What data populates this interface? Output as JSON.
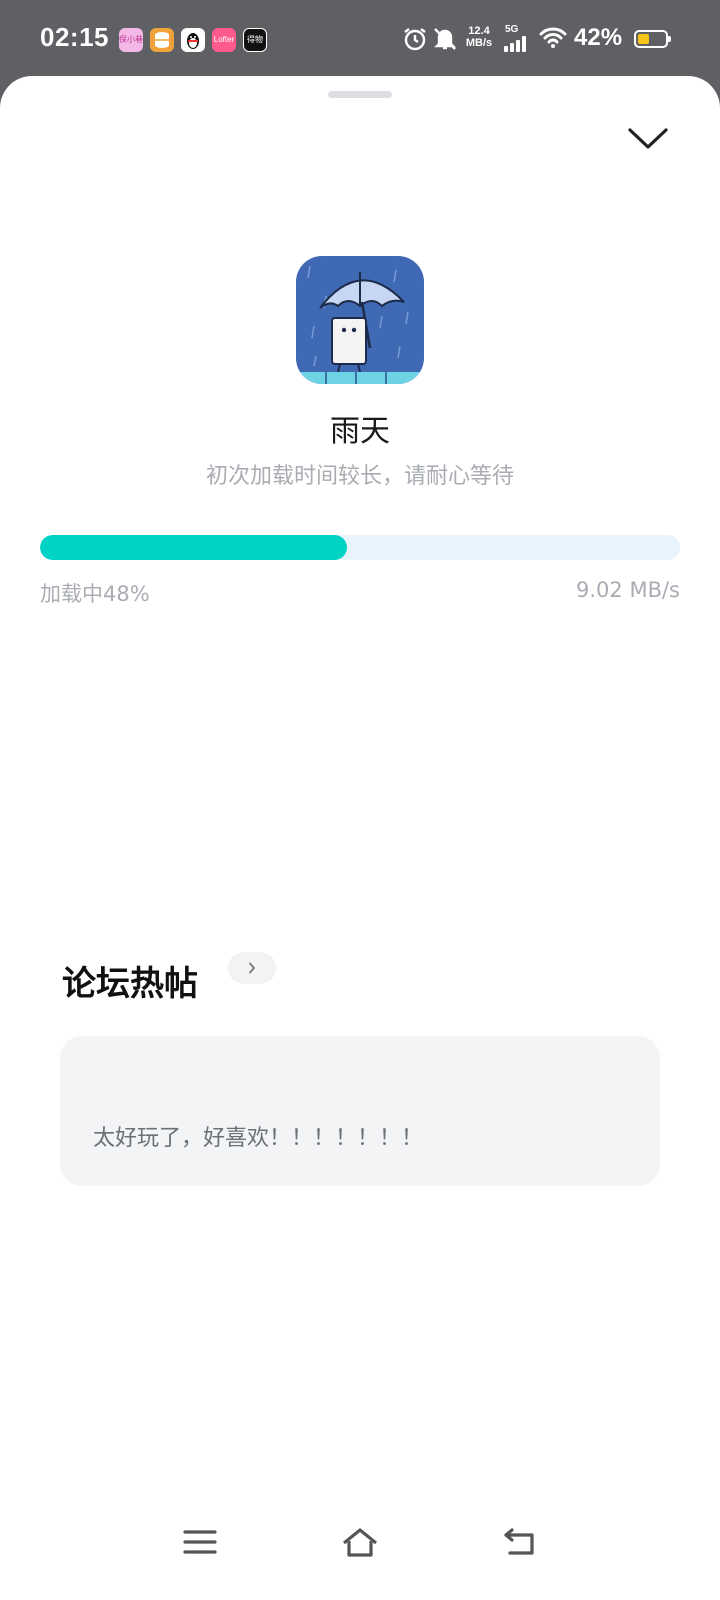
{
  "status_bar": {
    "time": "02:15",
    "notifications": [
      {
        "icon": "app-notification-icon",
        "text": "保小巷"
      },
      {
        "icon": "database-app-icon",
        "text": ""
      },
      {
        "icon": "qq-icon",
        "text": ""
      },
      {
        "icon": "lofter-app-icon",
        "text": "Lofter"
      },
      {
        "icon": "shopping-app-icon",
        "text": "得物"
      }
    ],
    "speed_value": "12.4",
    "speed_unit": "MB/s",
    "network": "5G",
    "battery_percent": "42%",
    "battery_level": 0.42
  },
  "app": {
    "name": "雨天",
    "hint": "初次加载时间较长，请耐心等待",
    "icon": "rainy-day-app-icon"
  },
  "loading": {
    "status": "加载中48%",
    "progress": 0.48,
    "speed": "9.02 MB/s"
  },
  "forum": {
    "title": "论坛热帖",
    "posts": [
      {
        "text": "太好玩了，好喜欢！！！！！！！"
      }
    ]
  },
  "colors": {
    "accent": "#00d3c3",
    "progress_track": "#e8f3fb",
    "muted_text": "#a9acb2",
    "card_bg": "#f3f4f6"
  }
}
